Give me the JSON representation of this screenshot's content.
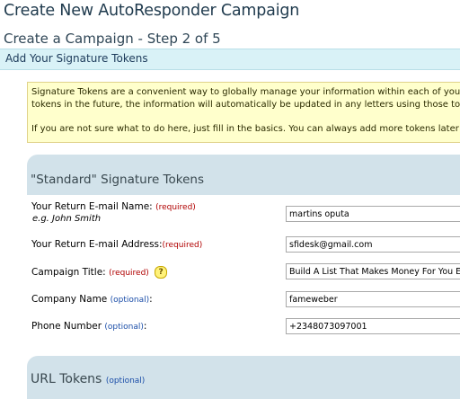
{
  "page": {
    "title": "Create New AutoResponder Campaign",
    "subtitle": "Create a Campaign - Step 2 of 5",
    "step_bar": "Add Your Signature Tokens"
  },
  "info_box": {
    "line1": "Signature Tokens are a convenient way to globally manage your information within each of your AutoResponder le",
    "line2": "tokens in the future, the information will automatically be updated in any letters using those tokens.",
    "line3": "If you are not sure what to do here, just fill in the basics. You can always add more tokens later from your Back O"
  },
  "standard_section": {
    "title": "\"Standard\" Signature Tokens",
    "fields": [
      {
        "label": "Your Return E-mail Name:",
        "tag": "(required)",
        "example": "e.g. John Smith",
        "value": "martins oputa"
      },
      {
        "label": "Your Return E-mail Address:",
        "tag": "(required)",
        "value": "sfidesk@gmail.com"
      },
      {
        "label": "Campaign Title:",
        "tag": "(required)",
        "help": "?",
        "value": "Build A List That Makes Money For You Easily"
      },
      {
        "label": "Company Name",
        "tag": "(optional)",
        "suffix": ":",
        "value": "fameweber"
      },
      {
        "label": "Phone Number",
        "tag": "(optional)",
        "suffix": ":",
        "value": "+2348073097001"
      }
    ]
  },
  "url_section": {
    "title": "URL Tokens",
    "tag": "(optional)"
  },
  "colors": {
    "step_bar_bg": "#d9f2f7",
    "info_bg": "#ffffcc",
    "section_bg": "#d2e2ea",
    "required": "#b00000",
    "optional": "#1a4da8"
  }
}
